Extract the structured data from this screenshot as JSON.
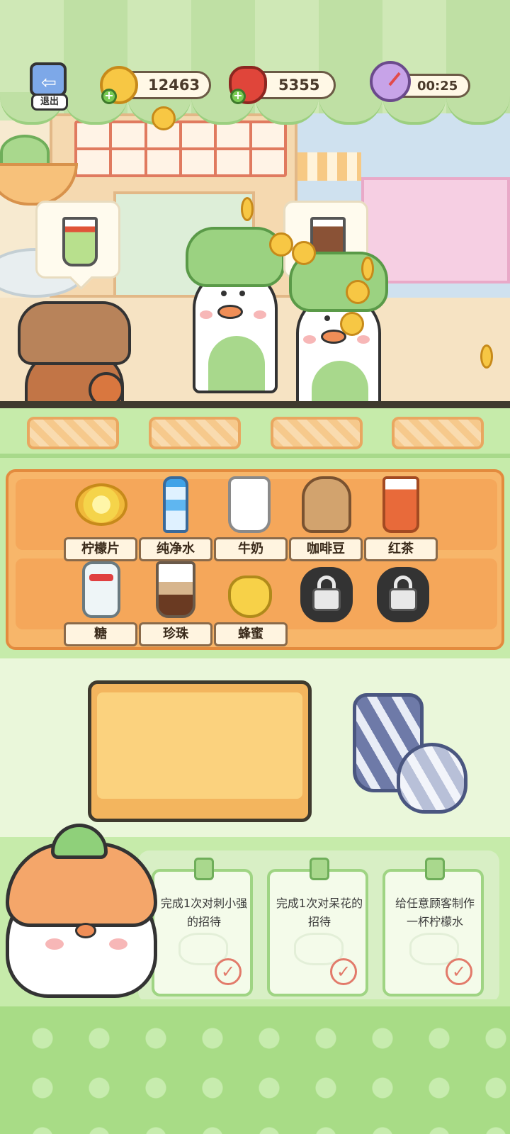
{
  "hud": {
    "exit_label": "退出",
    "gold": "12463",
    "gems": "5355",
    "timer": "00:25"
  },
  "ingredients": {
    "row1": [
      {
        "label": "柠檬片",
        "icon": "lemon-slices-icon"
      },
      {
        "label": "纯净水",
        "icon": "water-bottle-icon"
      },
      {
        "label": "牛奶",
        "icon": "milk-jug-icon"
      },
      {
        "label": "咖啡豆",
        "icon": "coffee-beans-icon"
      },
      {
        "label": "红茶",
        "icon": "black-tea-icon"
      }
    ],
    "row2": [
      {
        "label": "糖",
        "icon": "sugar-jar-icon"
      },
      {
        "label": "珍珠",
        "icon": "pearls-cup-icon"
      },
      {
        "label": "蜂蜜",
        "icon": "honey-pot-icon"
      }
    ],
    "locked_slots": 2
  },
  "tasks": [
    {
      "text": "完成1次对刺小强的招待"
    },
    {
      "text": "完成1次对呆花的招待"
    },
    {
      "text": "给任意顾客制作一杯柠檬水"
    }
  ],
  "check_glyph": "✓",
  "colors": {
    "accent_green": "#a8dc86",
    "shelf_orange": "#f7b66a",
    "coin_gold": "#f7c744"
  }
}
